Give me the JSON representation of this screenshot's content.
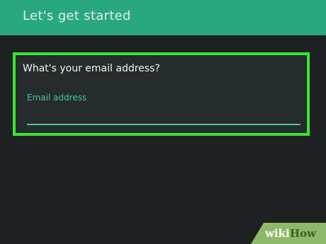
{
  "app_bar": {
    "title": "Let's get started"
  },
  "form": {
    "question": "What's your email address?",
    "email_field": {
      "label": "Email address",
      "value": ""
    }
  },
  "watermark": {
    "part1": "wiki",
    "part2": "How"
  },
  "colors": {
    "app_bar": "#29a781",
    "background": "#1e2121",
    "card": "#262b2b",
    "highlight_border": "#37e633",
    "accent": "#44c9a1",
    "watermark_bg": "#8fb96a"
  }
}
